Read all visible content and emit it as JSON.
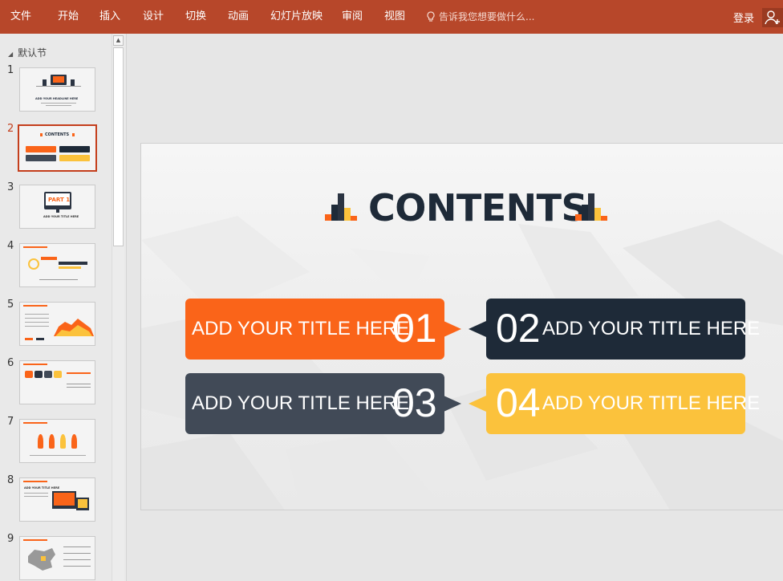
{
  "ribbon": {
    "tabs": [
      "文件",
      "开始",
      "插入",
      "设计",
      "切换",
      "动画",
      "幻灯片放映",
      "审阅",
      "视图"
    ],
    "tell_me": "告诉我您想要做什么...",
    "login": "登录"
  },
  "pane": {
    "section": "默认节",
    "slides": [
      {
        "num": "1",
        "text": "ADD YOUR HEADLINE HERE"
      },
      {
        "num": "2",
        "text": "CONTENTS"
      },
      {
        "num": "3",
        "text": "PART 1",
        "sub": "ADD YOUR TITLE HERE"
      },
      {
        "num": "4",
        "text": ""
      },
      {
        "num": "5",
        "text": ""
      },
      {
        "num": "6",
        "text": ""
      },
      {
        "num": "7",
        "text": ""
      },
      {
        "num": "8",
        "text": "ADD YOUR TITLE HERE"
      },
      {
        "num": "9",
        "text": ""
      }
    ]
  },
  "slide": {
    "title": "CONTENTS",
    "items": [
      {
        "label": "ADD YOUR TITLE HERE",
        "number": "01",
        "color": "#fa6419"
      },
      {
        "label": "ADD YOUR TITLE HERE",
        "number": "02",
        "color": "#1e2a38"
      },
      {
        "label": "ADD YOUR TITLE HERE",
        "number": "03",
        "color": "#414a57"
      },
      {
        "label": "ADD YOUR TITLE HERE",
        "number": "04",
        "color": "#fbc23c"
      }
    ]
  },
  "colors": {
    "ribbon": "#b7472a",
    "accent_orange": "#fa6419",
    "navy": "#1e2a38",
    "slate": "#414a57",
    "yellow": "#fbc23c",
    "selected_border": "#c43e1c"
  }
}
